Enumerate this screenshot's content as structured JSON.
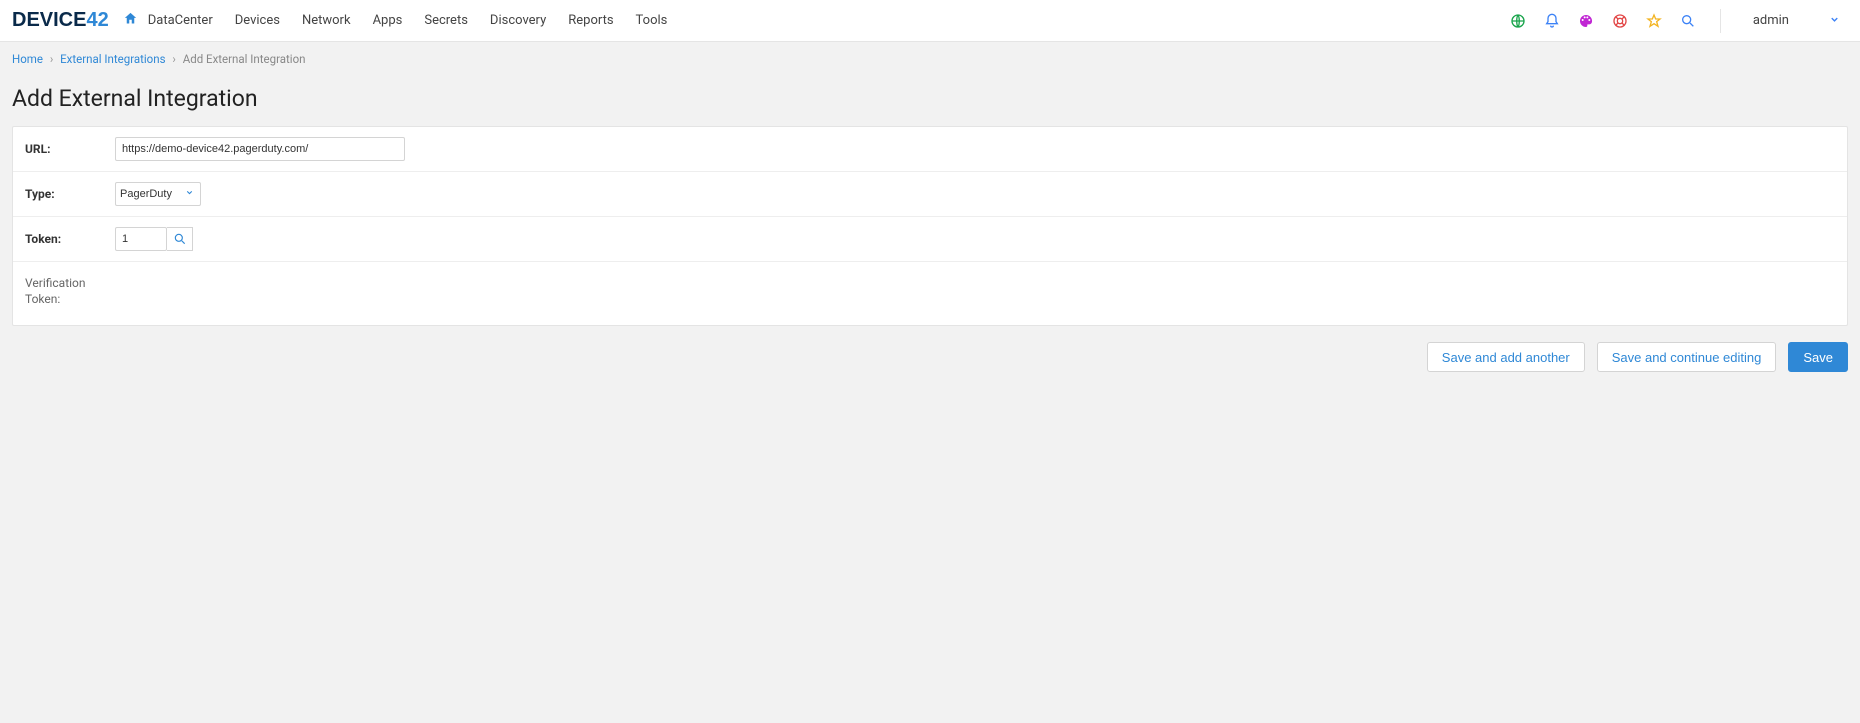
{
  "brand": {
    "prefix": "DEVIC",
    "e": "E",
    "suffix": "42"
  },
  "nav": {
    "items": [
      "DataCenter",
      "Devices",
      "Network",
      "Apps",
      "Secrets",
      "Discovery",
      "Reports",
      "Tools"
    ]
  },
  "user": {
    "name": "admin"
  },
  "breadcrumb": {
    "home": "Home",
    "parent": "External Integrations",
    "current": "Add External Integration"
  },
  "page": {
    "title": "Add External Integration"
  },
  "form": {
    "url_label": "URL:",
    "url_value": "https://demo-device42.pagerduty.com/",
    "type_label": "Type:",
    "type_value": "PagerDuty",
    "token_label": "Token:",
    "token_value": "1",
    "verification_label": "Verification Token:"
  },
  "buttons": {
    "save_add_another": "Save and add another",
    "save_continue": "Save and continue editing",
    "save": "Save"
  }
}
